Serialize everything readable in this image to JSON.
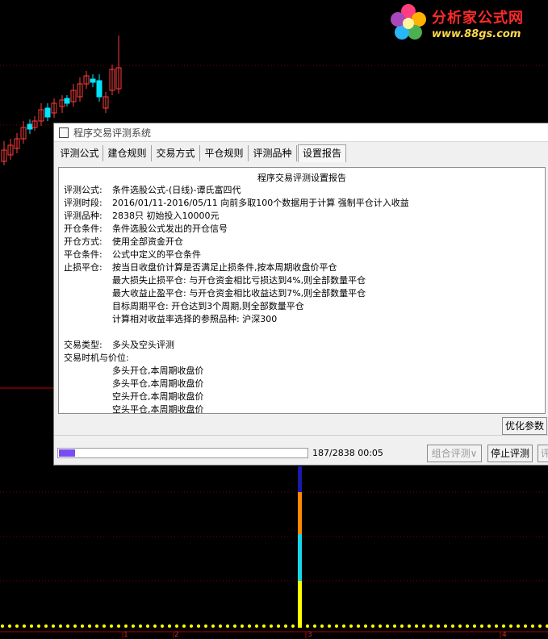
{
  "logo": {
    "title": "分析家公式网",
    "url": "www.88gs.com"
  },
  "window": {
    "title": "程序交易评测系统"
  },
  "tabs": [
    {
      "label": "评测公式",
      "active": false
    },
    {
      "label": "建仓规则",
      "active": false
    },
    {
      "label": "交易方式",
      "active": false
    },
    {
      "label": "平仓规则",
      "active": false
    },
    {
      "label": "评测品种",
      "active": false
    },
    {
      "label": "设置报告",
      "active": true
    }
  ],
  "report": {
    "title": "程序交易评测设置报告",
    "lines": [
      {
        "label": "评测公式:",
        "value": "条件选股公式-(日线)-谭氏富四代"
      },
      {
        "label": "评测时段:",
        "value": "2016/01/11-2016/05/11 向前多取100个数据用于计算 强制平仓计入收益"
      },
      {
        "label": "评测品种:",
        "value": "2838只 初始投入10000元"
      },
      {
        "label": "开仓条件:",
        "value": "条件选股公式发出的开仓信号"
      },
      {
        "label": "开仓方式:",
        "value": "使用全部资金开仓"
      },
      {
        "label": "平仓条件:",
        "value": "公式中定义的平仓条件"
      },
      {
        "label": "止损平仓:",
        "value": "按当日收盘价计算是否满足止损条件,按本周期收盘价平仓"
      },
      {
        "label": "",
        "value": "最大损失止损平仓: 与开仓资金相比亏损达到4%,则全部数量平仓"
      },
      {
        "label": "",
        "value": "最大收益止盈平仓: 与开仓资金相比收益达到7%,则全部数量平仓"
      },
      {
        "label": "",
        "value": "目标周期平仓: 开仓达到3个周期,则全部数量平仓"
      },
      {
        "label": "",
        "value": "计算相对收益率选择的参照品种: 沪深300"
      },
      {
        "label": "",
        "value": ""
      },
      {
        "label": "交易类型:",
        "value": "多头及空头评测"
      },
      {
        "label": "交易时机与价位:",
        "value": ""
      },
      {
        "label": "",
        "value": "多头开仓,本周期收盘价"
      },
      {
        "label": "",
        "value": "多头平仓,本周期收盘价"
      },
      {
        "label": "",
        "value": "空头开仓,本周期收盘价"
      },
      {
        "label": "",
        "value": "空头平仓,本周期收盘价"
      }
    ]
  },
  "buttons": {
    "optimize": "优化参数",
    "combo": "组合评测∨",
    "stop": "停止评测",
    "next_partial": "评"
  },
  "progress": {
    "current": 187,
    "total": 2838,
    "fraction": 0.066,
    "text": "187/2838  00:05"
  },
  "colors": {
    "progress_fill": "#7a4cf5",
    "rise_candle": "#ff3b3b",
    "fall_candle": "#00e5ff"
  },
  "axis_labels": [
    "1",
    "2",
    "3",
    "4"
  ]
}
